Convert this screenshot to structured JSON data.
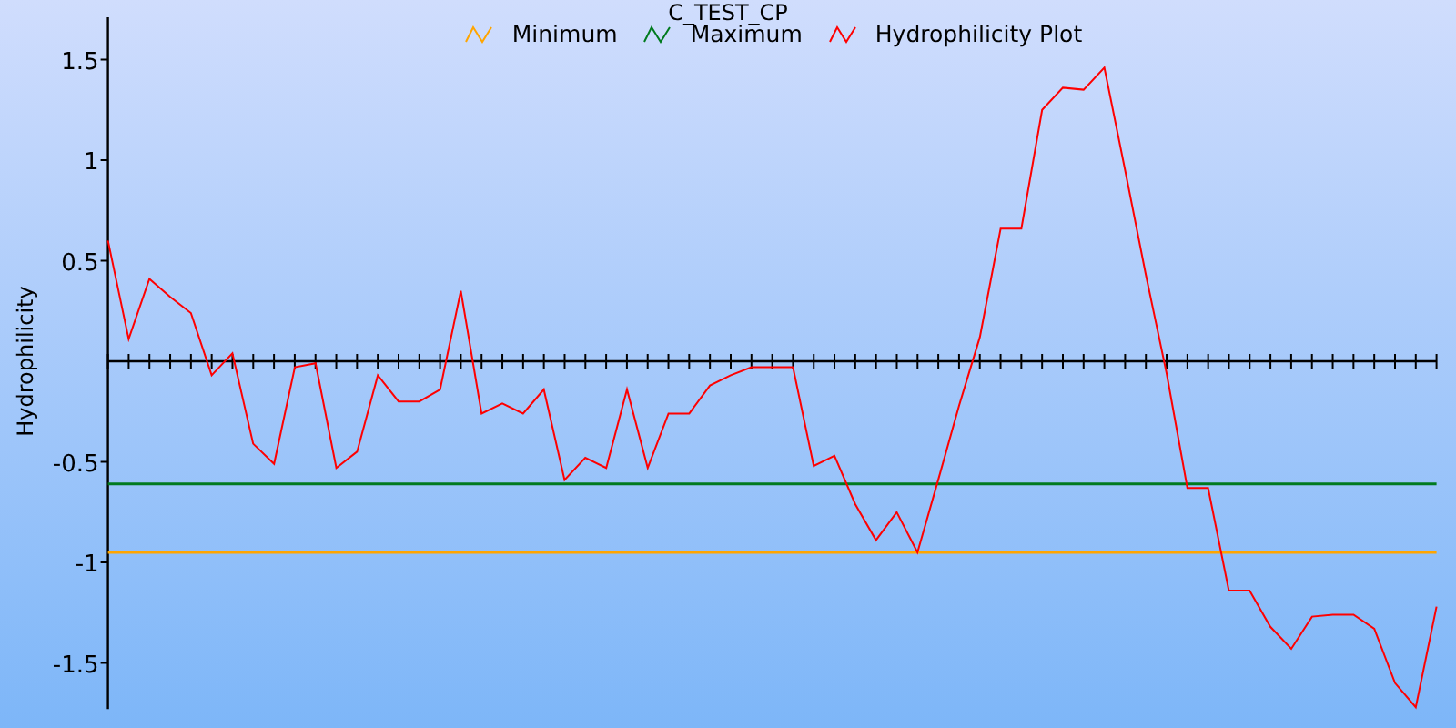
{
  "chart": {
    "chart_data": {
      "type": "line",
      "title": "C_TEST_CP",
      "ylabel": "Hydrophilicity",
      "legend": "top",
      "categories": [
        null,
        null,
        null,
        null,
        null,
        null,
        null,
        null,
        null,
        null,
        null,
        null,
        null,
        null,
        null,
        null,
        null,
        null,
        null,
        null,
        null,
        null,
        null,
        null,
        null,
        null,
        null,
        null,
        null,
        null,
        null,
        null,
        null,
        null,
        null,
        null,
        null,
        null,
        null,
        null,
        null,
        null,
        null,
        null,
        null,
        null,
        null,
        null,
        null,
        null,
        null,
        null,
        null,
        null,
        null,
        null,
        null,
        null,
        null,
        null,
        null,
        null,
        null,
        null,
        null
      ],
      "ylim": [
        -1.73,
        1.71
      ],
      "yticks": [
        -1.5,
        -1,
        -0.5,
        0.5,
        1,
        1.5
      ],
      "series": [
        {
          "name": "Minimum",
          "color": "#ffa500",
          "values": [
            -0.95,
            -0.95,
            -0.95,
            -0.95,
            -0.95,
            -0.95,
            -0.95,
            -0.95,
            -0.95,
            -0.95,
            -0.95,
            -0.95,
            -0.95,
            -0.95,
            -0.95,
            -0.95,
            -0.95,
            -0.95,
            -0.95,
            -0.95,
            -0.95,
            -0.95,
            -0.95,
            -0.95,
            -0.95,
            -0.95,
            -0.95,
            -0.95,
            -0.95,
            -0.95,
            -0.95,
            -0.95,
            -0.95,
            -0.95,
            -0.95,
            -0.95,
            -0.95,
            -0.95,
            -0.95,
            -0.95,
            -0.95,
            -0.95,
            -0.95,
            -0.95,
            -0.95,
            -0.95,
            -0.95,
            -0.95,
            -0.95,
            -0.95,
            -0.95,
            -0.95,
            -0.95,
            -0.95,
            -0.95,
            -0.95,
            -0.95,
            -0.95,
            -0.95,
            -0.95,
            -0.95,
            -0.95,
            -0.95,
            -0.95,
            -0.95
          ]
        },
        {
          "name": "Maximum",
          "color": "#007a1e",
          "values": [
            -0.61,
            -0.61,
            -0.61,
            -0.61,
            -0.61,
            -0.61,
            -0.61,
            -0.61,
            -0.61,
            -0.61,
            -0.61,
            -0.61,
            -0.61,
            -0.61,
            -0.61,
            -0.61,
            -0.61,
            -0.61,
            -0.61,
            -0.61,
            -0.61,
            -0.61,
            -0.61,
            -0.61,
            -0.61,
            -0.61,
            -0.61,
            -0.61,
            -0.61,
            -0.61,
            -0.61,
            -0.61,
            -0.61,
            -0.61,
            -0.61,
            -0.61,
            -0.61,
            -0.61,
            -0.61,
            -0.61,
            -0.61,
            -0.61,
            -0.61,
            -0.61,
            -0.61,
            -0.61,
            -0.61,
            -0.61,
            -0.61,
            -0.61,
            -0.61,
            -0.61,
            -0.61,
            -0.61,
            -0.61,
            -0.61,
            -0.61,
            -0.61,
            -0.61,
            -0.61,
            -0.61,
            -0.61,
            -0.61,
            -0.61,
            -0.61
          ]
        },
        {
          "name": "Hydrophilicity Plot",
          "color": "#ff0000",
          "values": [
            0.6,
            0.11,
            0.41,
            0.32,
            0.24,
            -0.07,
            0.04,
            -0.41,
            -0.51,
            -0.03,
            -0.01,
            -0.53,
            -0.45,
            -0.07,
            -0.2,
            -0.2,
            -0.14,
            0.35,
            -0.26,
            -0.21,
            -0.26,
            -0.14,
            -0.59,
            -0.48,
            -0.53,
            -0.14,
            -0.53,
            -0.26,
            -0.26,
            -0.12,
            -0.07,
            -0.03,
            -0.03,
            -0.03,
            -0.52,
            -0.47,
            -0.71,
            -0.89,
            -0.75,
            -0.95,
            -0.59,
            -0.22,
            0.12,
            0.66,
            0.66,
            1.25,
            1.36,
            1.35,
            1.46,
            0.95,
            0.43,
            -0.06,
            -0.63,
            -0.63,
            -1.14,
            -1.14,
            -1.32,
            -1.43,
            -1.27,
            -1.26,
            -1.26,
            -1.33,
            -1.6,
            -1.72,
            -1.22
          ]
        }
      ]
    }
  }
}
